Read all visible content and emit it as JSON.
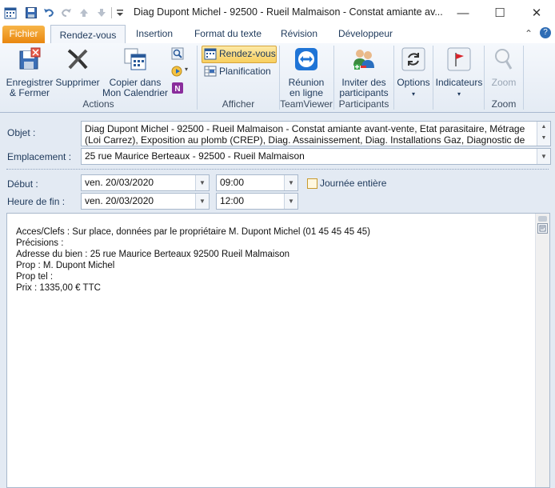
{
  "window": {
    "title": "Diag Dupont Michel - 92500 - Rueil Malmaison - Constat amiante av...",
    "minimize": "—",
    "maximize": "☐",
    "close": "✕"
  },
  "tabs": {
    "file": "Fichier",
    "items": [
      "Rendez-vous",
      "Insertion",
      "Format du texte",
      "Révision",
      "Développeur"
    ],
    "collapse": "⌃",
    "help": "?"
  },
  "ribbon": {
    "actions": {
      "label": "Actions",
      "save_close": [
        "Enregistrer",
        "& Fermer"
      ],
      "delete": "Supprimer",
      "copy_calendar": [
        "Copier dans",
        "Mon Calendrier"
      ]
    },
    "afficher": {
      "label": "Afficher",
      "appointment": "Rendez-vous",
      "planning": "Planification"
    },
    "teamviewer": {
      "label": "TeamViewer",
      "meeting": [
        "Réunion",
        "en ligne"
      ]
    },
    "participants": {
      "label": "Participants",
      "invite": [
        "Inviter des",
        "participants"
      ]
    },
    "options": {
      "label": "Options",
      "arrow": "▾"
    },
    "tags": {
      "label": "Indicateurs",
      "arrow": "▾"
    },
    "zoom": {
      "button": "Zoom",
      "label": "Zoom"
    }
  },
  "form": {
    "subject_label": "Objet :",
    "subject_value": "Diag Dupont Michel - 92500 - Rueil Malmaison - Constat amiante avant-vente, Etat parasitaire, Métrage (Loi Carrez), Exposition au plomb (CREP), Diag. Assainissement, Diag. Installations Gaz, Diagnostic de Performance",
    "location_label": "Emplacement :",
    "location_value": "25 rue Maurice Berteaux - 92500 - Rueil Malmaison",
    "start_label": "Début :",
    "start_date": "ven. 20/03/2020",
    "start_time": "09:00",
    "all_day_label": "Journée entière",
    "end_label": "Heure de fin :",
    "end_date": "ven. 20/03/2020",
    "end_time": "12:00"
  },
  "body": {
    "lines": [
      "Acces/Clefs : Sur place, données par le propriétaire M. Dupont Michel (01 45 45 45 45)",
      "Précisions :",
      "Adresse du bien : 25 rue Maurice Berteaux 92500 Rueil Malmaison",
      "Prop : M. Dupont Michel",
      "Prop tel :",
      "Prix : 1335,00 € TTC"
    ]
  },
  "colors": {
    "file_tab": "#f0a020",
    "ribbon_bg": "#e4ebf4",
    "form_bg": "#e3eaf3",
    "text_blue": "#1e395b"
  }
}
